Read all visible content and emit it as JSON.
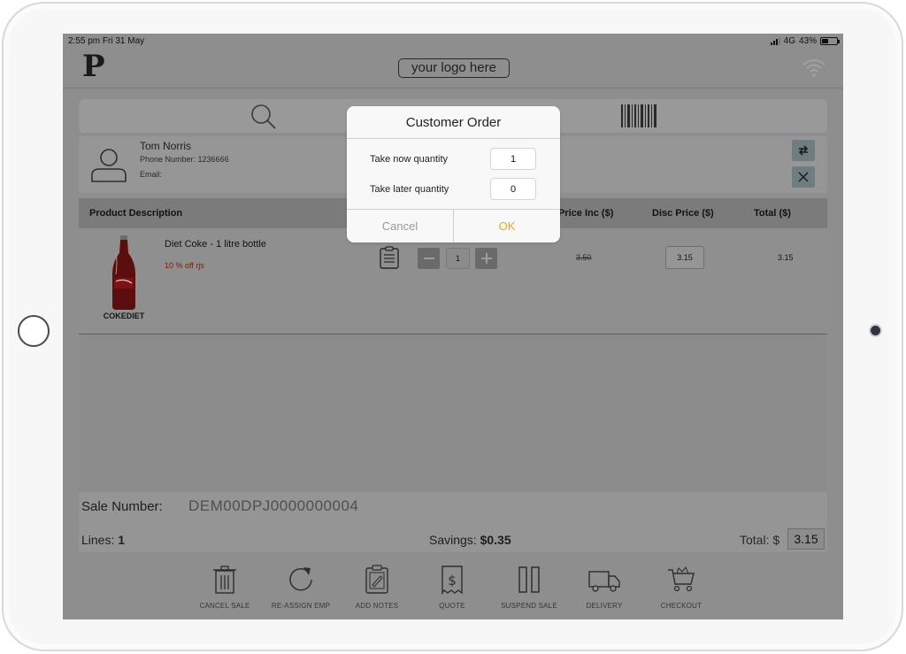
{
  "status_bar": {
    "time_date": "2:55 pm  Fri 31 May",
    "network": "4G",
    "battery": "43%",
    "battery_level": 0.43
  },
  "header": {
    "brand_letter": "P",
    "logo_text": "your logo here"
  },
  "customer": {
    "name": "Tom Norris",
    "phone": "Phone Number: 1236666",
    "email": "Email:"
  },
  "table": {
    "columns": {
      "description": "Product Description",
      "price_inc": "Price Inc ($)",
      "disc_price": "Disc Price ($)",
      "total": "Total ($)"
    },
    "rows": [
      {
        "sku": "COKEDIET",
        "name": "Diet Coke - 1 litre bottle",
        "promo": "10 % off rjs",
        "qty": "1",
        "price_inc": "3.50",
        "disc_price": "3.15",
        "total": "3.15"
      }
    ]
  },
  "summary": {
    "sale_label": "Sale Number:",
    "sale_number": "DEM00DPJ0000000004",
    "lines_label": "Lines:",
    "lines_value": "1",
    "savings_label": "Savings:",
    "savings_value": "$0.35",
    "total_label": "Total: $",
    "total_value": "3.15"
  },
  "toolbar": {
    "cancel_sale": "CANCEL SALE",
    "reassign_emp": "RE-ASSIGN EMP",
    "add_notes": "ADD NOTES",
    "quote": "QUOTE",
    "suspend_sale": "SUSPEND SALE",
    "delivery": "DELIVERY",
    "checkout": "CHECKOUT"
  },
  "dialog": {
    "title": "Customer Order",
    "take_now_label": "Take now quantity",
    "take_now_value": "1",
    "take_later_label": "Take later quantity",
    "take_later_value": "0",
    "cancel": "Cancel",
    "ok": "OK"
  },
  "icons": [
    "search-icon",
    "barcode-icon",
    "user-avatar-icon",
    "swap-icon",
    "close-icon",
    "clipboard-notes-icon",
    "minus-icon",
    "plus-icon",
    "trash-icon",
    "reassign-icon",
    "notes-icon",
    "quote-receipt-icon",
    "pause-icon",
    "truck-icon",
    "cart-icon",
    "wifi-icon"
  ],
  "colors": {
    "ok_accent": "#e6ad00",
    "promo_text": "#7a1d00",
    "overlay_gray": "#8e8e8e"
  }
}
